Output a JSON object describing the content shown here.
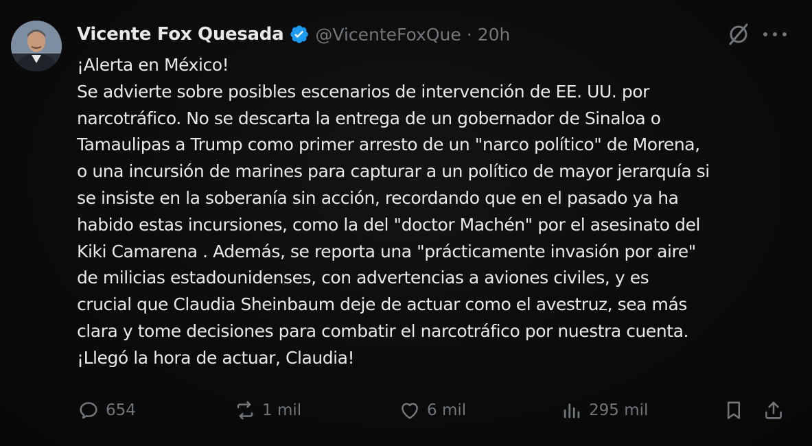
{
  "author": {
    "name": "Vicente Fox Quesada",
    "handle": "@VicenteFoxQue",
    "separator": "·",
    "time": "20h"
  },
  "tweet": {
    "lines": [
      "¡Alerta en México!",
      "Se advierte sobre posibles escenarios de intervención de EE. UU. por",
      "narcotráfico. No se descarta la entrega de un gobernador de Sinaloa o",
      "Tamaulipas a Trump como primer arresto de un \"narco político\" de Morena,",
      "o una incursión de marines para capturar a un político de mayor jerarquía si",
      "se insiste en la soberanía sin acción, recordando que en el pasado ya ha",
      "habido estas incursiones, como la del \"doctor Machén\" por el asesinato del",
      "Kiki Camarena . Además, se reporta una \"prácticamente invasión por aire\"",
      "de milicias estadounidenses, con advertencias a aviones civiles, y es",
      "crucial que Claudia Sheinbaum deje de actuar como el avestruz, sea más",
      "clara y tome decisiones para combatir el narcotráfico por nuestra cuenta.",
      "¡Llegó la hora de actuar, Claudia!"
    ]
  },
  "actions": {
    "replies": "654",
    "reposts": "1 mil",
    "likes": "6 mil",
    "views": "295 mil"
  },
  "icons": {
    "verified": "verified-badge-icon",
    "grok": "grok-icon",
    "more": "more-icon",
    "reply": "reply-icon",
    "repost": "repost-icon",
    "like": "heart-icon",
    "views": "views-icon",
    "bookmark": "bookmark-icon",
    "share": "share-icon"
  },
  "colors": {
    "background": "#0b0b0b",
    "text": "#e7e9ea",
    "muted": "#71767b",
    "verified": "#1d9bf0"
  }
}
